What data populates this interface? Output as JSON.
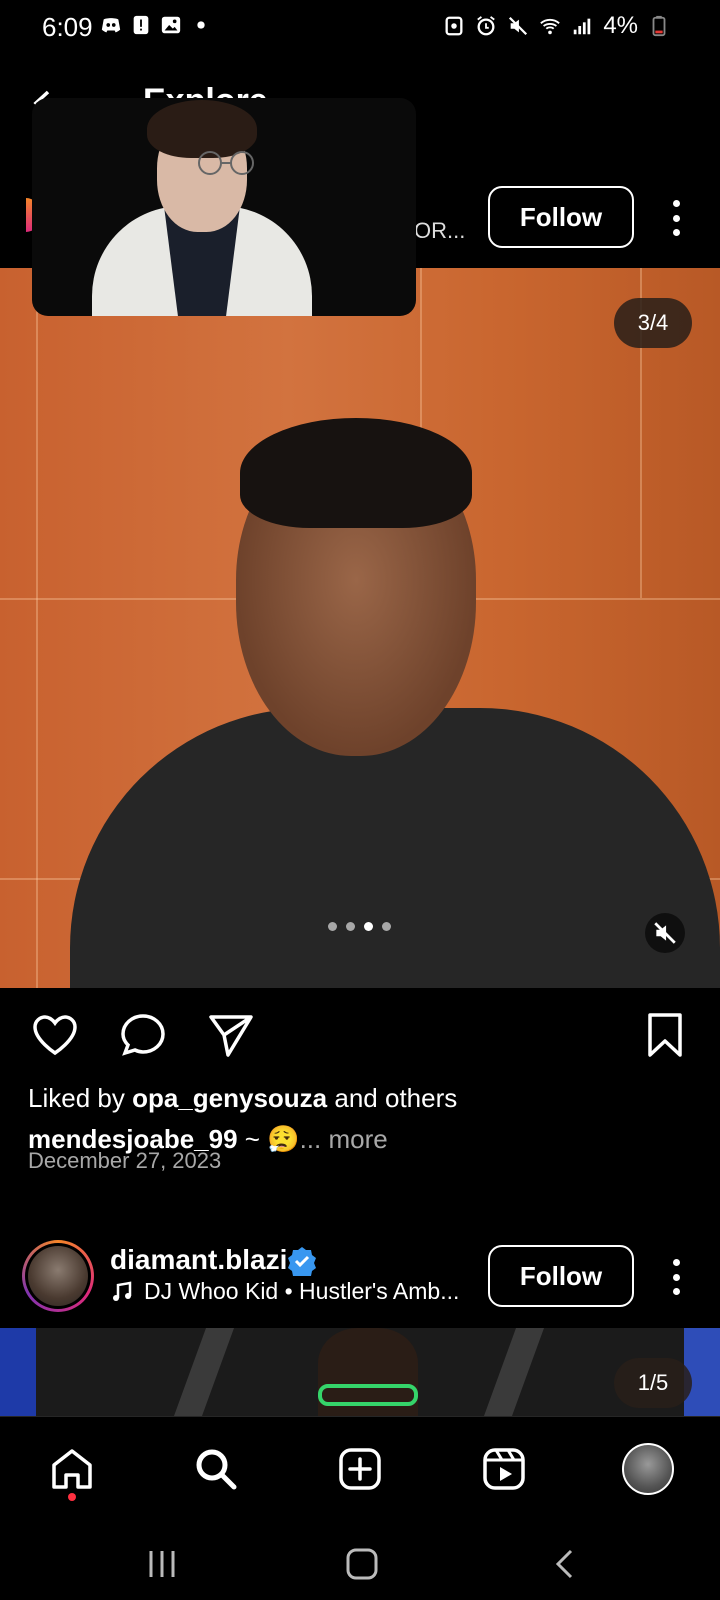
{
  "status_bar": {
    "time": "6:09",
    "battery": "4%",
    "left_icons": [
      "discord-icon",
      "alert-icon",
      "gallery-icon",
      "dot-icon"
    ],
    "right_icons": [
      "nfc-icon",
      "alarm-icon",
      "mute-icon",
      "wifi-icon",
      "signal-icon",
      "battery-icon"
    ]
  },
  "header": {
    "title": "Explore"
  },
  "post1": {
    "username_truncated": "OR...",
    "follow_label": "Follow",
    "image_counter": "3/4",
    "carousel_count": 4,
    "carousel_active": 3,
    "liked_prefix": "Liked by",
    "liked_user": "opa_genysouza",
    "liked_suffix": "and others",
    "caption_user": "mendesjoabe_99",
    "caption_text": "~ 😮‍💨",
    "caption_more": "... more",
    "date": "December 27, 2023"
  },
  "post2": {
    "username": "diamant.blazi",
    "verified": true,
    "music": "DJ Whoo Kid • Hustler's Amb...",
    "follow_label": "Follow",
    "image_counter": "1/5"
  },
  "bottom_nav": {
    "items": [
      "home-icon",
      "search-icon",
      "create-icon",
      "reels-icon",
      "profile-avatar"
    ]
  },
  "colors": {
    "background": "#000000",
    "notification_dot": "#ff3040",
    "verified_blue": "#3897f0",
    "couch_orange": "#c8612f"
  }
}
